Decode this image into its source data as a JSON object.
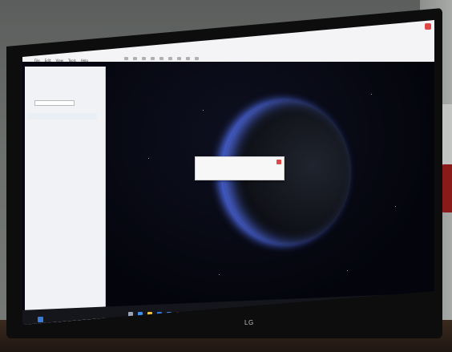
{
  "window": {
    "menu_items": [
      "File",
      "Edit",
      "View",
      "Tools",
      "Help"
    ],
    "toolbar_icon_count": 9
  },
  "sidebar": {
    "input_placeholder": "",
    "list_item": ""
  },
  "dialog": {
    "text": ""
  },
  "taskbar": {
    "app_icons": [
      {
        "name": "start-icon",
        "color": "#3a7bd5"
      },
      {
        "name": "search-icon",
        "color": "#9aa3b3"
      },
      {
        "name": "browser-icon",
        "color": "#3a8ef0"
      },
      {
        "name": "explorer-icon",
        "color": "#f3c13a"
      },
      {
        "name": "store-icon",
        "color": "#2f7be0"
      },
      {
        "name": "mail-icon",
        "color": "#4a7cd6"
      },
      {
        "name": "app-icon",
        "color": "#e05a5a"
      },
      {
        "name": "app-active-icon",
        "color": "#c8c8c8"
      },
      {
        "name": "app-icon-2",
        "color": "#7ac0f0"
      }
    ],
    "tray_text": ""
  },
  "monitor": {
    "brand": "LG"
  },
  "colors": {
    "space": "#04050c",
    "earth_glow": "#5066f0",
    "window_chrome": "#f4f4f6"
  }
}
